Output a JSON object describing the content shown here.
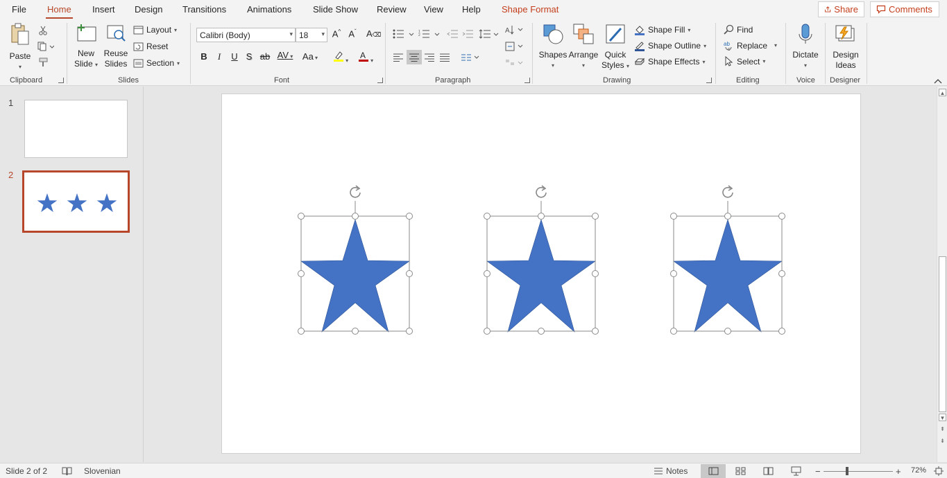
{
  "menu": {
    "tabs": [
      "File",
      "Home",
      "Insert",
      "Design",
      "Transitions",
      "Animations",
      "Slide Show",
      "Review",
      "View",
      "Help",
      "Shape Format"
    ],
    "active": "Home",
    "share_label": "Share",
    "comments_label": "Comments"
  },
  "ribbon": {
    "clipboard": {
      "label": "Clipboard",
      "paste": "Paste"
    },
    "slides": {
      "label": "Slides",
      "new_slide_1": "New",
      "new_slide_2": "Slide",
      "reuse_1": "Reuse",
      "reuse_2": "Slides",
      "layout": "Layout",
      "reset": "Reset",
      "section": "Section"
    },
    "font": {
      "label": "Font",
      "font_name": "Calibri (Body)",
      "font_size": "18",
      "bold": "B",
      "italic": "I",
      "underline": "U",
      "shadow": "S",
      "strike": "ab",
      "spacing": "AV",
      "case": "Aa"
    },
    "paragraph": {
      "label": "Paragraph"
    },
    "drawing": {
      "label": "Drawing",
      "shapes": "Shapes",
      "arrange": "Arrange",
      "quick_1": "Quick",
      "quick_2": "Styles",
      "shape_fill": "Shape Fill",
      "shape_outline": "Shape Outline",
      "shape_effects": "Shape Effects"
    },
    "editing": {
      "label": "Editing",
      "find": "Find",
      "replace": "Replace",
      "select": "Select"
    },
    "voice": {
      "label": "Voice",
      "dictate": "Dictate"
    },
    "designer": {
      "label": "Designer",
      "ideas_1": "Design",
      "ideas_2": "Ideas"
    }
  },
  "thumbnails": [
    {
      "number": "1",
      "selected": false
    },
    {
      "number": "2",
      "selected": true
    }
  ],
  "slide": {
    "shape_color": "#4472c4",
    "shapes": [
      "star",
      "star",
      "star"
    ]
  },
  "status": {
    "slide_info": "Slide 2 of 2",
    "language": "Slovenian",
    "notes": "Notes",
    "zoom": "72%",
    "zoom_minus": "−",
    "zoom_plus": "+"
  },
  "colors": {
    "accent": "#b7472a",
    "highlight": "#ffff00",
    "font_color": "#c00000",
    "star": "#4472c4"
  }
}
